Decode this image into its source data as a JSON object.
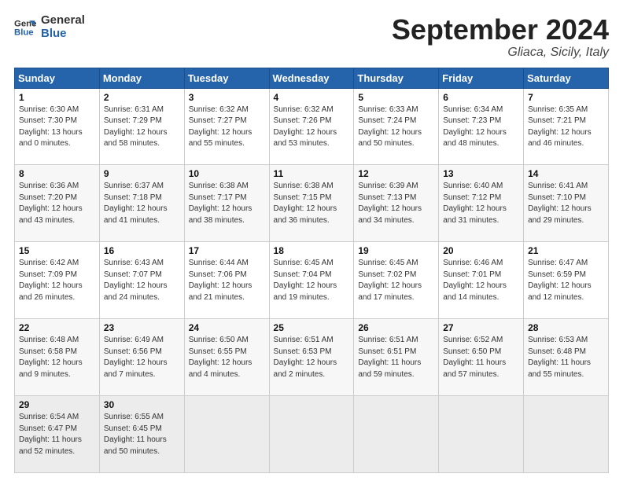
{
  "logo": {
    "line1": "General",
    "line2": "Blue"
  },
  "title": "September 2024",
  "location": "Gliaca, Sicily, Italy",
  "days_of_week": [
    "Sunday",
    "Monday",
    "Tuesday",
    "Wednesday",
    "Thursday",
    "Friday",
    "Saturday"
  ],
  "weeks": [
    [
      {
        "day": 1,
        "lines": [
          "Sunrise: 6:30 AM",
          "Sunset: 7:30 PM",
          "Daylight: 13 hours",
          "and 0 minutes."
        ]
      },
      {
        "day": 2,
        "lines": [
          "Sunrise: 6:31 AM",
          "Sunset: 7:29 PM",
          "Daylight: 12 hours",
          "and 58 minutes."
        ]
      },
      {
        "day": 3,
        "lines": [
          "Sunrise: 6:32 AM",
          "Sunset: 7:27 PM",
          "Daylight: 12 hours",
          "and 55 minutes."
        ]
      },
      {
        "day": 4,
        "lines": [
          "Sunrise: 6:32 AM",
          "Sunset: 7:26 PM",
          "Daylight: 12 hours",
          "and 53 minutes."
        ]
      },
      {
        "day": 5,
        "lines": [
          "Sunrise: 6:33 AM",
          "Sunset: 7:24 PM",
          "Daylight: 12 hours",
          "and 50 minutes."
        ]
      },
      {
        "day": 6,
        "lines": [
          "Sunrise: 6:34 AM",
          "Sunset: 7:23 PM",
          "Daylight: 12 hours",
          "and 48 minutes."
        ]
      },
      {
        "day": 7,
        "lines": [
          "Sunrise: 6:35 AM",
          "Sunset: 7:21 PM",
          "Daylight: 12 hours",
          "and 46 minutes."
        ]
      }
    ],
    [
      {
        "day": 8,
        "lines": [
          "Sunrise: 6:36 AM",
          "Sunset: 7:20 PM",
          "Daylight: 12 hours",
          "and 43 minutes."
        ]
      },
      {
        "day": 9,
        "lines": [
          "Sunrise: 6:37 AM",
          "Sunset: 7:18 PM",
          "Daylight: 12 hours",
          "and 41 minutes."
        ]
      },
      {
        "day": 10,
        "lines": [
          "Sunrise: 6:38 AM",
          "Sunset: 7:17 PM",
          "Daylight: 12 hours",
          "and 38 minutes."
        ]
      },
      {
        "day": 11,
        "lines": [
          "Sunrise: 6:38 AM",
          "Sunset: 7:15 PM",
          "Daylight: 12 hours",
          "and 36 minutes."
        ]
      },
      {
        "day": 12,
        "lines": [
          "Sunrise: 6:39 AM",
          "Sunset: 7:13 PM",
          "Daylight: 12 hours",
          "and 34 minutes."
        ]
      },
      {
        "day": 13,
        "lines": [
          "Sunrise: 6:40 AM",
          "Sunset: 7:12 PM",
          "Daylight: 12 hours",
          "and 31 minutes."
        ]
      },
      {
        "day": 14,
        "lines": [
          "Sunrise: 6:41 AM",
          "Sunset: 7:10 PM",
          "Daylight: 12 hours",
          "and 29 minutes."
        ]
      }
    ],
    [
      {
        "day": 15,
        "lines": [
          "Sunrise: 6:42 AM",
          "Sunset: 7:09 PM",
          "Daylight: 12 hours",
          "and 26 minutes."
        ]
      },
      {
        "day": 16,
        "lines": [
          "Sunrise: 6:43 AM",
          "Sunset: 7:07 PM",
          "Daylight: 12 hours",
          "and 24 minutes."
        ]
      },
      {
        "day": 17,
        "lines": [
          "Sunrise: 6:44 AM",
          "Sunset: 7:06 PM",
          "Daylight: 12 hours",
          "and 21 minutes."
        ]
      },
      {
        "day": 18,
        "lines": [
          "Sunrise: 6:45 AM",
          "Sunset: 7:04 PM",
          "Daylight: 12 hours",
          "and 19 minutes."
        ]
      },
      {
        "day": 19,
        "lines": [
          "Sunrise: 6:45 AM",
          "Sunset: 7:02 PM",
          "Daylight: 12 hours",
          "and 17 minutes."
        ]
      },
      {
        "day": 20,
        "lines": [
          "Sunrise: 6:46 AM",
          "Sunset: 7:01 PM",
          "Daylight: 12 hours",
          "and 14 minutes."
        ]
      },
      {
        "day": 21,
        "lines": [
          "Sunrise: 6:47 AM",
          "Sunset: 6:59 PM",
          "Daylight: 12 hours",
          "and 12 minutes."
        ]
      }
    ],
    [
      {
        "day": 22,
        "lines": [
          "Sunrise: 6:48 AM",
          "Sunset: 6:58 PM",
          "Daylight: 12 hours",
          "and 9 minutes."
        ]
      },
      {
        "day": 23,
        "lines": [
          "Sunrise: 6:49 AM",
          "Sunset: 6:56 PM",
          "Daylight: 12 hours",
          "and 7 minutes."
        ]
      },
      {
        "day": 24,
        "lines": [
          "Sunrise: 6:50 AM",
          "Sunset: 6:55 PM",
          "Daylight: 12 hours",
          "and 4 minutes."
        ]
      },
      {
        "day": 25,
        "lines": [
          "Sunrise: 6:51 AM",
          "Sunset: 6:53 PM",
          "Daylight: 12 hours",
          "and 2 minutes."
        ]
      },
      {
        "day": 26,
        "lines": [
          "Sunrise: 6:51 AM",
          "Sunset: 6:51 PM",
          "Daylight: 11 hours",
          "and 59 minutes."
        ]
      },
      {
        "day": 27,
        "lines": [
          "Sunrise: 6:52 AM",
          "Sunset: 6:50 PM",
          "Daylight: 11 hours",
          "and 57 minutes."
        ]
      },
      {
        "day": 28,
        "lines": [
          "Sunrise: 6:53 AM",
          "Sunset: 6:48 PM",
          "Daylight: 11 hours",
          "and 55 minutes."
        ]
      }
    ],
    [
      {
        "day": 29,
        "lines": [
          "Sunrise: 6:54 AM",
          "Sunset: 6:47 PM",
          "Daylight: 11 hours",
          "and 52 minutes."
        ]
      },
      {
        "day": 30,
        "lines": [
          "Sunrise: 6:55 AM",
          "Sunset: 6:45 PM",
          "Daylight: 11 hours",
          "and 50 minutes."
        ]
      },
      null,
      null,
      null,
      null,
      null
    ]
  ]
}
